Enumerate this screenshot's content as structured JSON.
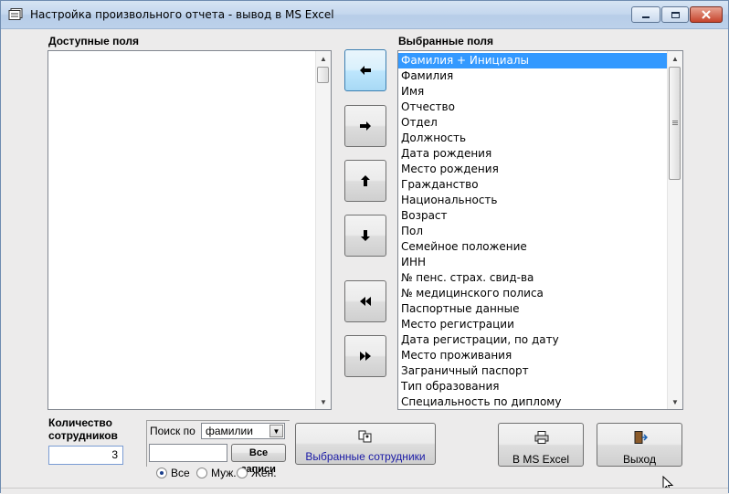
{
  "window": {
    "title": "Настройка произвольного отчета - вывод в MS Excel",
    "controls": [
      "minimize",
      "maximize",
      "close"
    ]
  },
  "available": {
    "label": "Доступные поля",
    "items": []
  },
  "selected": {
    "label": "Выбранные поля",
    "items": [
      "Фамилия + Инициалы",
      "Фамилия",
      "Имя",
      "Отчество",
      "Отдел",
      "Должность",
      "Дата рождения",
      "Место рождения",
      "Гражданство",
      "Национальность",
      "Возраст",
      "Пол",
      "Семейное положение",
      "ИНН",
      "№ пенс. страх. свид-ва",
      "№ медицинского полиса",
      "Паспортные данные",
      "Место регистрации",
      "Дата регистрации, по дату",
      "Место проживания",
      "Заграничный паспорт",
      "Тип образования",
      "Специальность по диплому"
    ],
    "selected_index": 0
  },
  "move_buttons": {
    "icons": [
      "arrow-left-icon",
      "arrow-right-icon",
      "arrow-up-icon",
      "arrow-down-icon",
      "double-left-icon",
      "double-right-icon"
    ]
  },
  "employee_count": {
    "label_line1": "Количество",
    "label_line2": "сотрудников",
    "value": "3"
  },
  "search": {
    "label": "Поиск по",
    "field_value": "фамилии",
    "input_value": "",
    "all_records_label": "Все записи",
    "filter_options": [
      "Все",
      "Муж.",
      "Жен."
    ],
    "filter_selected": "Все"
  },
  "buttons": {
    "selected_employees": "Выбранные сотрудники",
    "excel": "В MS Excel",
    "exit": "Выход"
  },
  "colors": {
    "selection": "#3399ff",
    "link_text": "#1a1aa6"
  }
}
